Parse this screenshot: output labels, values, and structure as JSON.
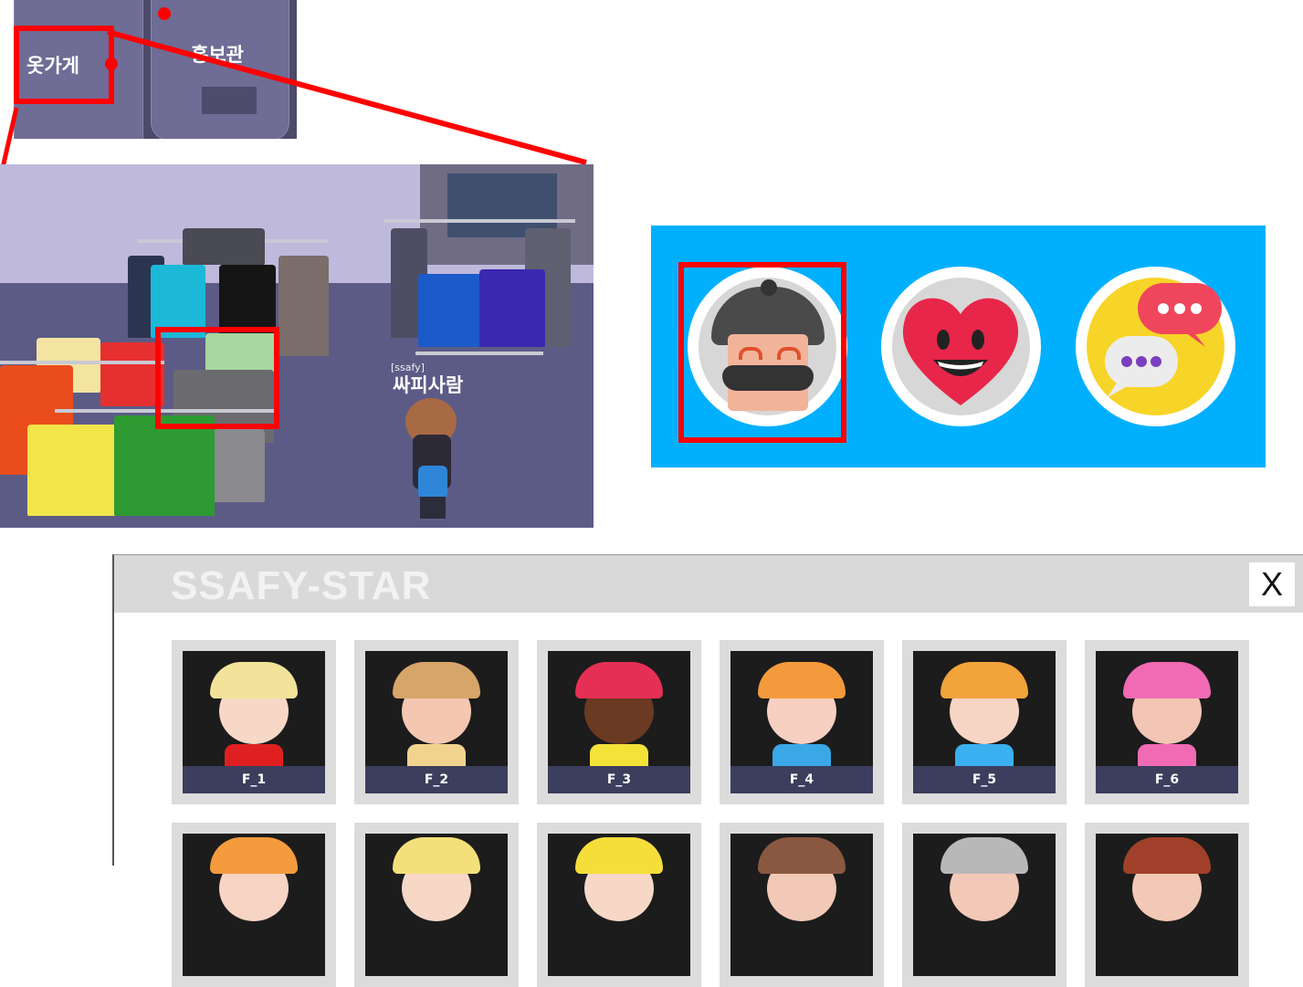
{
  "minimap": {
    "label_clothes_store": "옷가게",
    "label_promo_hall": "홍보관"
  },
  "scene": {
    "player_tag": "[ssafy]",
    "player_name": "싸피사람"
  },
  "emoji_panel": {
    "icons": [
      "avatar-icon",
      "heart-face-icon",
      "chat-icon"
    ],
    "background": "#00b0ff",
    "highlight": "#ff0000"
  },
  "dialog": {
    "title": "SSAFY-STAR",
    "close_label": "X",
    "characters": [
      {
        "label": "F_1",
        "skin": "#f7d8c6",
        "hat": "#f3e39a",
        "shirt": "#e02020"
      },
      {
        "label": "F_2",
        "skin": "#f4c7b0",
        "hat": "#d6a56a",
        "shirt": "#f1d38d"
      },
      {
        "label": "F_3",
        "skin": "#6b3a22",
        "hat": "#e62f55",
        "shirt": "#f3e238"
      },
      {
        "label": "F_4",
        "skin": "#f7d0c1",
        "hat": "#f39a3c",
        "shirt": "#3aa7e6"
      },
      {
        "label": "F_5",
        "skin": "#f7d5c5",
        "hat": "#f2a33a",
        "shirt": "#3ab0f0"
      },
      {
        "label": "F_6",
        "skin": "#f2c5b4",
        "hat": "#f06ab4",
        "shirt": "#f06ab4"
      }
    ],
    "row2": [
      {
        "skin": "#f7d4c4",
        "hat": "#f39b3d"
      },
      {
        "skin": "#f7d8c6",
        "hat": "#f3e07a"
      },
      {
        "skin": "#f7d8c6",
        "hat": "#f6de3a"
      },
      {
        "skin": "#f2c9b6",
        "hat": "#8a5840"
      },
      {
        "skin": "#f2c9b6",
        "hat": "#b8b8b8"
      },
      {
        "skin": "#f2c9b6",
        "hat": "#a0402a"
      }
    ]
  }
}
